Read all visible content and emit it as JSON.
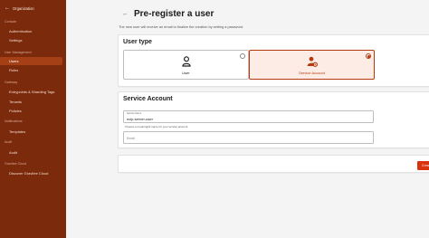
{
  "sidebar": {
    "back_label": "Organization",
    "sections": [
      {
        "title": "Console",
        "items": [
          {
            "label": "Authentication"
          },
          {
            "label": "Settings"
          }
        ]
      },
      {
        "title": "User Management",
        "items": [
          {
            "label": "Users"
          },
          {
            "label": "Roles"
          }
        ]
      },
      {
        "title": "Gateway",
        "items": [
          {
            "label": "Entrypoints & Sharding Tags"
          },
          {
            "label": "Tenants"
          },
          {
            "label": "Policies"
          }
        ]
      },
      {
        "title": "Notifications",
        "items": [
          {
            "label": "Templates"
          }
        ]
      },
      {
        "title": "Audit",
        "items": [
          {
            "label": "Audit"
          }
        ]
      },
      {
        "title": "Gravitee Cloud",
        "items": [
          {
            "label": "Discover Gravitee Cloud"
          }
        ]
      }
    ],
    "active_item": "Users"
  },
  "header": {
    "title": "Pre-register a user",
    "subtitle": "The new user will receive an email to finalize the creation by setting a password."
  },
  "user_type": {
    "title": "User type",
    "options": [
      {
        "label": "User",
        "icon": "user-icon",
        "selected": false
      },
      {
        "label": "Service Account",
        "icon": "user-gear-icon",
        "selected": true
      }
    ]
  },
  "service_account": {
    "title": "Service Account",
    "name_field": {
      "label": "Service Name",
      "value": "ncip-server-user"
    },
    "name_help": "Choose a meaningful name for your service account",
    "email_field": {
      "placeholder": "Email"
    }
  },
  "actions": {
    "create_label": "Create"
  },
  "colors": {
    "sidebar": "#7c2a0c",
    "accent": "#d9320e",
    "selected_border": "#b53a0f"
  }
}
